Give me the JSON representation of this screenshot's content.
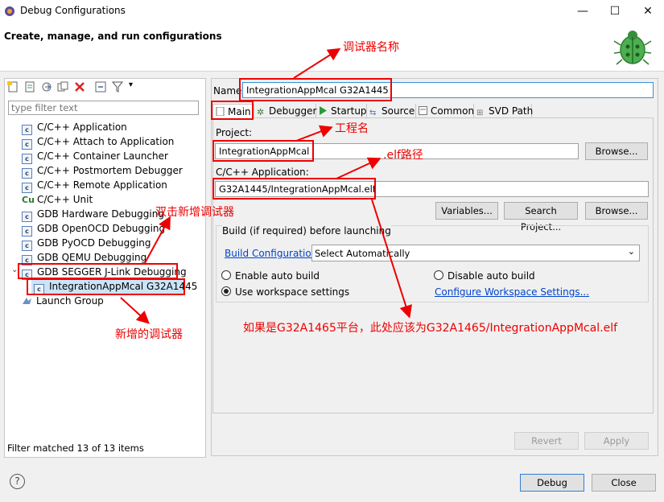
{
  "window": {
    "title": "Debug Configurations",
    "subtitle": "Create, manage, and run configurations",
    "controls": [
      "—",
      "☐",
      "✕"
    ]
  },
  "left": {
    "filter_placeholder": "type filter text",
    "tree": [
      {
        "label": "C/C++ Application",
        "icon": "c-icon"
      },
      {
        "label": "C/C++ Attach to Application",
        "icon": "c-icon"
      },
      {
        "label": "C/C++ Container Launcher",
        "icon": "c-icon"
      },
      {
        "label": "C/C++ Postmortem Debugger",
        "icon": "c-icon"
      },
      {
        "label": "C/C++ Remote Application",
        "icon": "c-icon"
      },
      {
        "label": "C/C++ Unit",
        "icon": "cu-icon"
      },
      {
        "label": "GDB Hardware Debugging",
        "icon": "c-icon"
      },
      {
        "label": "GDB OpenOCD Debugging",
        "icon": "c-icon"
      },
      {
        "label": "GDB PyOCD Debugging",
        "icon": "c-icon"
      },
      {
        "label": "GDB QEMU Debugging",
        "icon": "c-icon"
      },
      {
        "label": "GDB SEGGER J-Link Debugging",
        "icon": "c-icon",
        "expanded": true
      },
      {
        "label": "IntegrationAppMcal G32A1445",
        "icon": "c-icon",
        "child": true,
        "selected": true
      },
      {
        "label": "Launch Group",
        "icon": "launch-group-icon"
      }
    ],
    "status": "Filter matched 13 of 13 items"
  },
  "right": {
    "name_label": "Name:",
    "name_value": "IntegrationAppMcal G32A1445",
    "tabs": [
      "Main",
      "Debugger",
      "Startup",
      "Source",
      "Common",
      "SVD Path"
    ],
    "project_label": "Project:",
    "project_value": "IntegrationAppMcal",
    "browse_label": "Browse...",
    "app_label": "C/C++ Application:",
    "app_value": "G32A1445/IntegrationAppMcal.elf",
    "variables_label": "Variables...",
    "search_project_label": "Search Project...",
    "browse2_label": "Browse...",
    "build_group_label": "Build (if required) before launching",
    "build_config_link": "Build Configuration:",
    "build_config_value": "Select Automatically",
    "enable_auto_build": "Enable auto build",
    "disable_auto_build": "Disable auto build",
    "use_workspace": "Use workspace settings",
    "configure_workspace_link": "Configure Workspace Settings...",
    "revert_label": "Revert",
    "apply_label": "Apply"
  },
  "footer": {
    "help": "?",
    "debug_label": "Debug",
    "close_label": "Close"
  },
  "annotations": {
    "debugger_name": "调试器名称",
    "project_name": "工程名",
    "elf_path": ".elf路径",
    "double_click": "双击新增调试器",
    "new_debugger": "新增的调试器",
    "note": "如果是G32A1465平台，此处应该为G32A1465/IntegrationAppMcal.elf"
  },
  "colors": {
    "annotation": "#e00000",
    "link": "#0044cc",
    "selection": "#cce4f7"
  }
}
